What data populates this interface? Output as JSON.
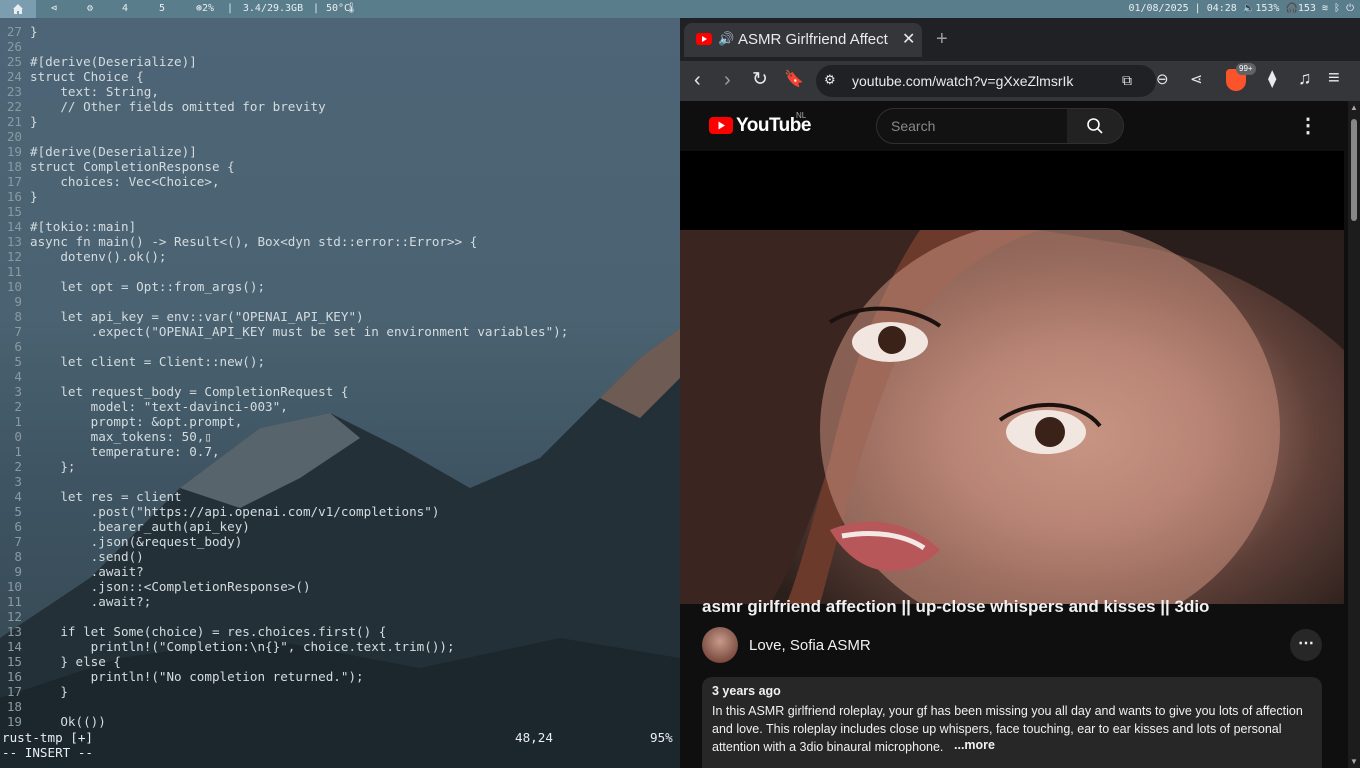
{
  "topbar": {
    "workspaces": [
      "4",
      "5"
    ],
    "cpu": "2%",
    "memory": "3.4/29.3GB",
    "temp": "50°C",
    "datetime": "01/08/2025 | 04:28",
    "volume": "153%",
    "headphones": "153"
  },
  "editor": {
    "lines": [
      {
        "n": "27",
        "t": "}"
      },
      {
        "n": "26",
        "t": ""
      },
      {
        "n": "25",
        "t": "#[derive(Deserialize)]"
      },
      {
        "n": "24",
        "t": "struct Choice {"
      },
      {
        "n": "23",
        "t": "    text: String,"
      },
      {
        "n": "22",
        "t": "    // Other fields omitted for brevity"
      },
      {
        "n": "21",
        "t": "}"
      },
      {
        "n": "20",
        "t": ""
      },
      {
        "n": "19",
        "t": "#[derive(Deserialize)]"
      },
      {
        "n": "18",
        "t": "struct CompletionResponse {"
      },
      {
        "n": "17",
        "t": "    choices: Vec<Choice>,"
      },
      {
        "n": "16",
        "t": "}"
      },
      {
        "n": "15",
        "t": ""
      },
      {
        "n": "14",
        "t": "#[tokio::main]"
      },
      {
        "n": "13",
        "t": "async fn main() -> Result<(), Box<dyn std::error::Error>> {"
      },
      {
        "n": "12",
        "t": "    dotenv().ok();"
      },
      {
        "n": "11",
        "t": ""
      },
      {
        "n": "10",
        "t": "    let opt = Opt::from_args();"
      },
      {
        "n": "9",
        "t": ""
      },
      {
        "n": "8",
        "t": "    let api_key = env::var(\"OPENAI_API_KEY\")"
      },
      {
        "n": "7",
        "t": "        .expect(\"OPENAI_API_KEY must be set in environment variables\");"
      },
      {
        "n": "6",
        "t": ""
      },
      {
        "n": "5",
        "t": "    let client = Client::new();"
      },
      {
        "n": "4",
        "t": ""
      },
      {
        "n": "3",
        "t": "    let request_body = CompletionRequest {"
      },
      {
        "n": "2",
        "t": "        model: \"text-davinci-003\","
      },
      {
        "n": "1",
        "t": "        prompt: &opt.prompt,"
      },
      {
        "n": "0",
        "t": "        max_tokens: 50,▯"
      },
      {
        "n": "1",
        "t": "        temperature: 0.7,"
      },
      {
        "n": "2",
        "t": "    };"
      },
      {
        "n": "3",
        "t": ""
      },
      {
        "n": "4",
        "t": "    let res = client"
      },
      {
        "n": "5",
        "t": "        .post(\"https://api.openai.com/v1/completions\")"
      },
      {
        "n": "6",
        "t": "        .bearer_auth(api_key)"
      },
      {
        "n": "7",
        "t": "        .json(&request_body)"
      },
      {
        "n": "8",
        "t": "        .send()"
      },
      {
        "n": "9",
        "t": "        .await?"
      },
      {
        "n": "10",
        "t": "        .json::<CompletionResponse>()"
      },
      {
        "n": "11",
        "t": "        .await?;"
      },
      {
        "n": "12",
        "t": ""
      },
      {
        "n": "13",
        "t": "    if let Some(choice) = res.choices.first() {"
      },
      {
        "n": "14",
        "t": "        println!(\"Completion:\\n{}\", choice.text.trim());"
      },
      {
        "n": "15",
        "t": "    } else {"
      },
      {
        "n": "16",
        "t": "        println!(\"No completion returned.\");"
      },
      {
        "n": "17",
        "t": "    }"
      },
      {
        "n": "18",
        "t": ""
      },
      {
        "n": "19",
        "t": "    Ok(())"
      }
    ],
    "status_file": "rust-tmp [+]",
    "status_pos": "48,24",
    "status_pct": "95%",
    "mode": "-- INSERT --"
  },
  "browser": {
    "tab_title": "ASMR Girlfriend Affect",
    "url": "youtube.com/watch?v=gXxeZlmsrIk",
    "badge": "99+",
    "colors": {
      "accent": "#ff0000",
      "brave": "#fb542b"
    }
  },
  "youtube": {
    "logo_text": "YouTube",
    "region": "NL",
    "search_placeholder": "Search",
    "video_title": "asmr girlfriend affection || up-close whispers and kisses || 3dio",
    "channel": "Love, Sofia ASMR",
    "age": "3 years ago",
    "description": "In this ASMR girlfriend roleplay, your gf has been missing you all day and wants to give you lots of affection and love. This roleplay includes close up whispers, face touching, ear to ear kisses and lots of personal attention with a 3dio binaural microphone.",
    "more": "...more"
  }
}
